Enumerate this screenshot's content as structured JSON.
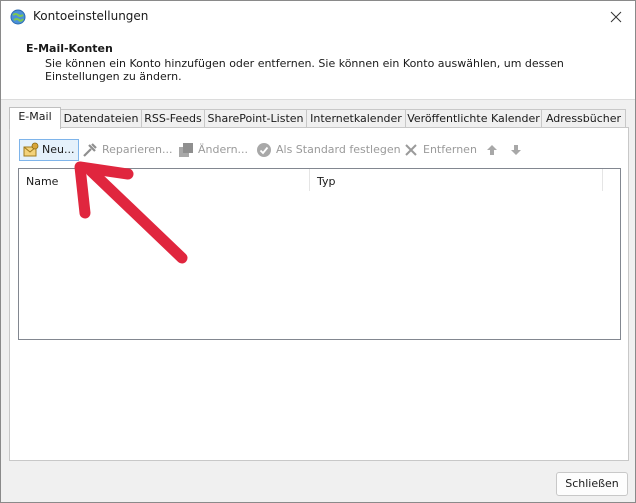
{
  "window": {
    "title": "Kontoeinstellungen"
  },
  "header": {
    "title": "E-Mail-Konten",
    "description": "Sie können ein Konto hinzufügen oder entfernen. Sie können ein Konto auswählen, um dessen Einstellungen zu ändern."
  },
  "tabs": [
    {
      "label": "E-Mail",
      "active": true
    },
    {
      "label": "Datendateien",
      "active": false
    },
    {
      "label": "RSS-Feeds",
      "active": false
    },
    {
      "label": "SharePoint-Listen",
      "active": false
    },
    {
      "label": "Internetkalender",
      "active": false
    },
    {
      "label": "Veröffentlichte Kalender",
      "active": false
    },
    {
      "label": "Adressbücher",
      "active": false
    }
  ],
  "toolbar": {
    "new_label": "Neu...",
    "repair_label": "Reparieren...",
    "change_label": "Ändern...",
    "set_default_label": "Als Standard festlegen",
    "remove_label": "Entfernen"
  },
  "list": {
    "columns": [
      "Name",
      "Typ"
    ],
    "rows": []
  },
  "footer": {
    "close_label": "Schließen"
  },
  "colors": {
    "annotation_arrow": "#e0263e",
    "accent": "#0078d4"
  },
  "icons": [
    "globe-icon",
    "close-icon",
    "new-account-icon",
    "repair-icon",
    "change-icon",
    "checkmark-icon",
    "remove-icon",
    "move-up-icon",
    "move-down-icon"
  ]
}
